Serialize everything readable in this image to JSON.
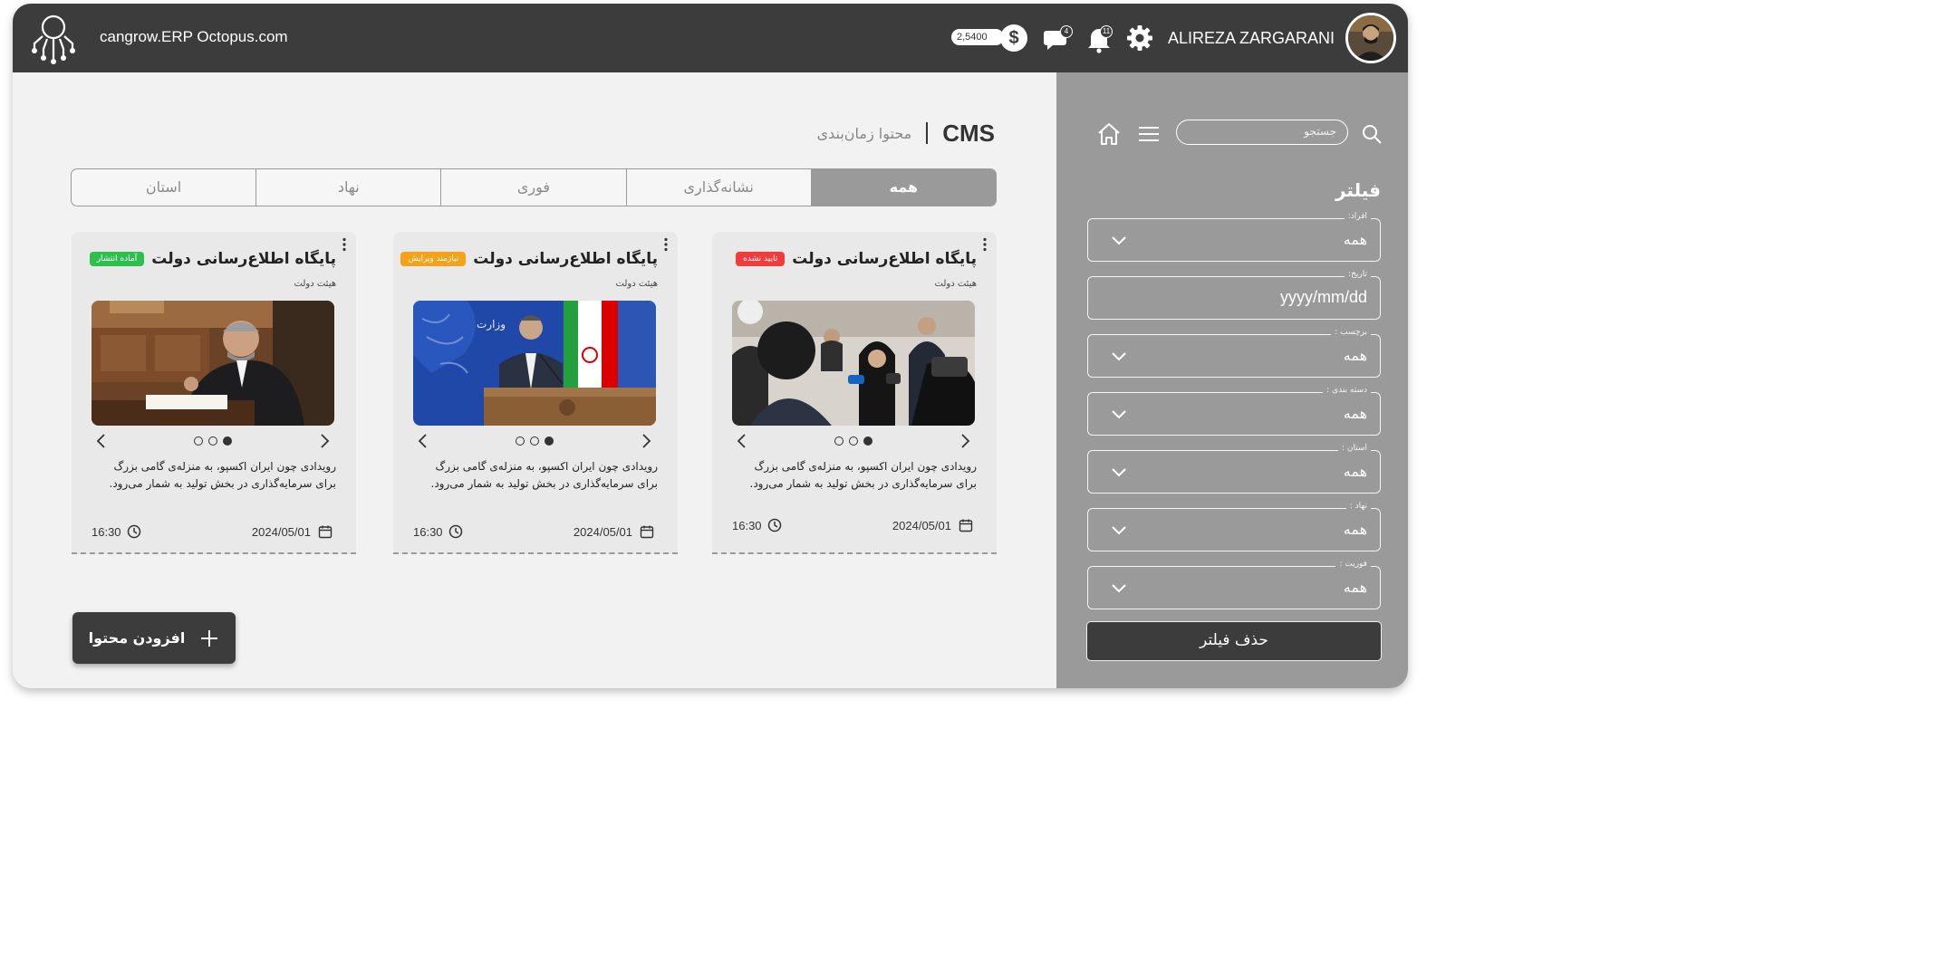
{
  "header": {
    "brand": "cangrow.ERP Octopus.com",
    "balance": "2,5400",
    "currency_symbol": "$",
    "messages_badge": "4",
    "notifications_badge": "11",
    "username": "ALIREZA ZARGARANI",
    "bg_color": "#3c3c3c"
  },
  "page": {
    "title": "CMS",
    "subtitle": "محتوا زمان‌بندی"
  },
  "tabs": [
    {
      "label": "همه",
      "active": true
    },
    {
      "label": "نشانه‌گذاری",
      "active": false
    },
    {
      "label": "فوری",
      "active": false
    },
    {
      "label": "نهاد",
      "active": false
    },
    {
      "label": "استان",
      "active": false
    }
  ],
  "cards": [
    {
      "title": "پایگاه اطلاع‌رسانی دولت",
      "status": "تایید نشده",
      "status_color": "#f23b3b",
      "org": "هیئت دولت",
      "text": "رویدادی چون ایران اکسپو، به منزله‌ی گامی بزرگ برای سرمایه‌گذاری در بخش تولید به شمار می‌رود.",
      "date": "2024/05/01",
      "time": "16:30"
    },
    {
      "title": "پایگاه اطلاع‌رسانی دولت",
      "status": "نیازمند ویرایش",
      "status_color": "#f5a21b",
      "org": "هیئت دولت",
      "text": "رویدادی چون ایران اکسپو، به منزله‌ی گامی بزرگ برای سرمایه‌گذاری در بخش تولید به شمار می‌رود.",
      "date": "2024/05/01",
      "time": "16:30"
    },
    {
      "title": "پایگاه اطلاع‌رسانی دولت",
      "status": "آماده انتشار",
      "status_color": "#2fbf4f",
      "org": "هیئت دولت",
      "text": "رویدادی چون ایران اکسپو، به منزله‌ی گامی بزرگ برای سرمایه‌گذاری در بخش تولید به شمار می‌رود.",
      "date": "2024/05/01",
      "time": "16:30"
    }
  ],
  "add_button": {
    "label": "افزودن محتوا"
  },
  "sidebar": {
    "search_placeholder": "جستجو",
    "filter_title": "فیلتر",
    "fields": [
      {
        "label": "افراد:",
        "value": "همه"
      },
      {
        "label": "تاریخ:",
        "value": "yyyy/mm/dd"
      },
      {
        "label": "برچسب :",
        "value": "همه"
      },
      {
        "label": "دسته بندی :",
        "value": "همه"
      },
      {
        "label": "استان :",
        "value": "همه"
      },
      {
        "label": "نهاد :",
        "value": "همه"
      },
      {
        "label": "فوریت :",
        "value": "همه"
      }
    ],
    "clear_label": "حذف فیلتر",
    "bg_color": "#9a9a9a"
  }
}
